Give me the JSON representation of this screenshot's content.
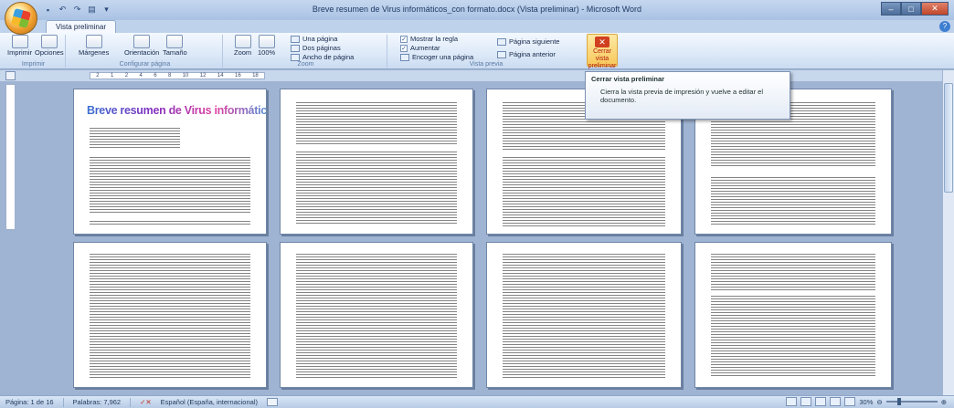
{
  "window": {
    "title": "Breve resumen de Virus informáticos_con formato.docx (Vista preliminar) - Microsoft Word"
  },
  "tabs": {
    "active": "Vista preliminar"
  },
  "ribbon": {
    "groups": {
      "imprimir": "Imprimir",
      "configurar": "Configurar página",
      "zoom": "Zoom",
      "vista_previa": "Vista previa"
    },
    "buttons": {
      "imprimir": "Imprimir",
      "opciones": "Opciones",
      "margenes": "Márgenes",
      "orientacion": "Orientación",
      "tamano": "Tamaño",
      "zoom": "Zoom",
      "zoom100": "100%",
      "una_pagina": "Una página",
      "dos_paginas": "Dos páginas",
      "ancho_pagina": "Ancho de página",
      "mostrar_regla": "Mostrar la regla",
      "aumentar": "Aumentar",
      "encoger": "Encoger una página",
      "pagina_siguiente": "Página siguiente",
      "pagina_anterior": "Página anterior",
      "cerrar_vista_l1": "Cerrar vista",
      "cerrar_vista_l2": "preliminar"
    }
  },
  "ruler": {
    "ticks": [
      "2",
      "1",
      "2",
      "4",
      "6",
      "8",
      "10",
      "12",
      "14",
      "16",
      "18"
    ]
  },
  "tooltip": {
    "title": "Cerrar vista preliminar",
    "body": "Cierra la vista previa de impresión y vuelve a editar el documento."
  },
  "document": {
    "heading": "Breve resumen de Virus informáticos"
  },
  "status": {
    "page": "Página: 1 de 16",
    "words": "Palabras: 7,962",
    "language": "Español (España, internacional)",
    "zoom": "30%"
  },
  "colors": {
    "ribbon_bg": "#dde9f8",
    "canvas_bg": "#9fb4d2",
    "highlight": "#f8c85a"
  }
}
